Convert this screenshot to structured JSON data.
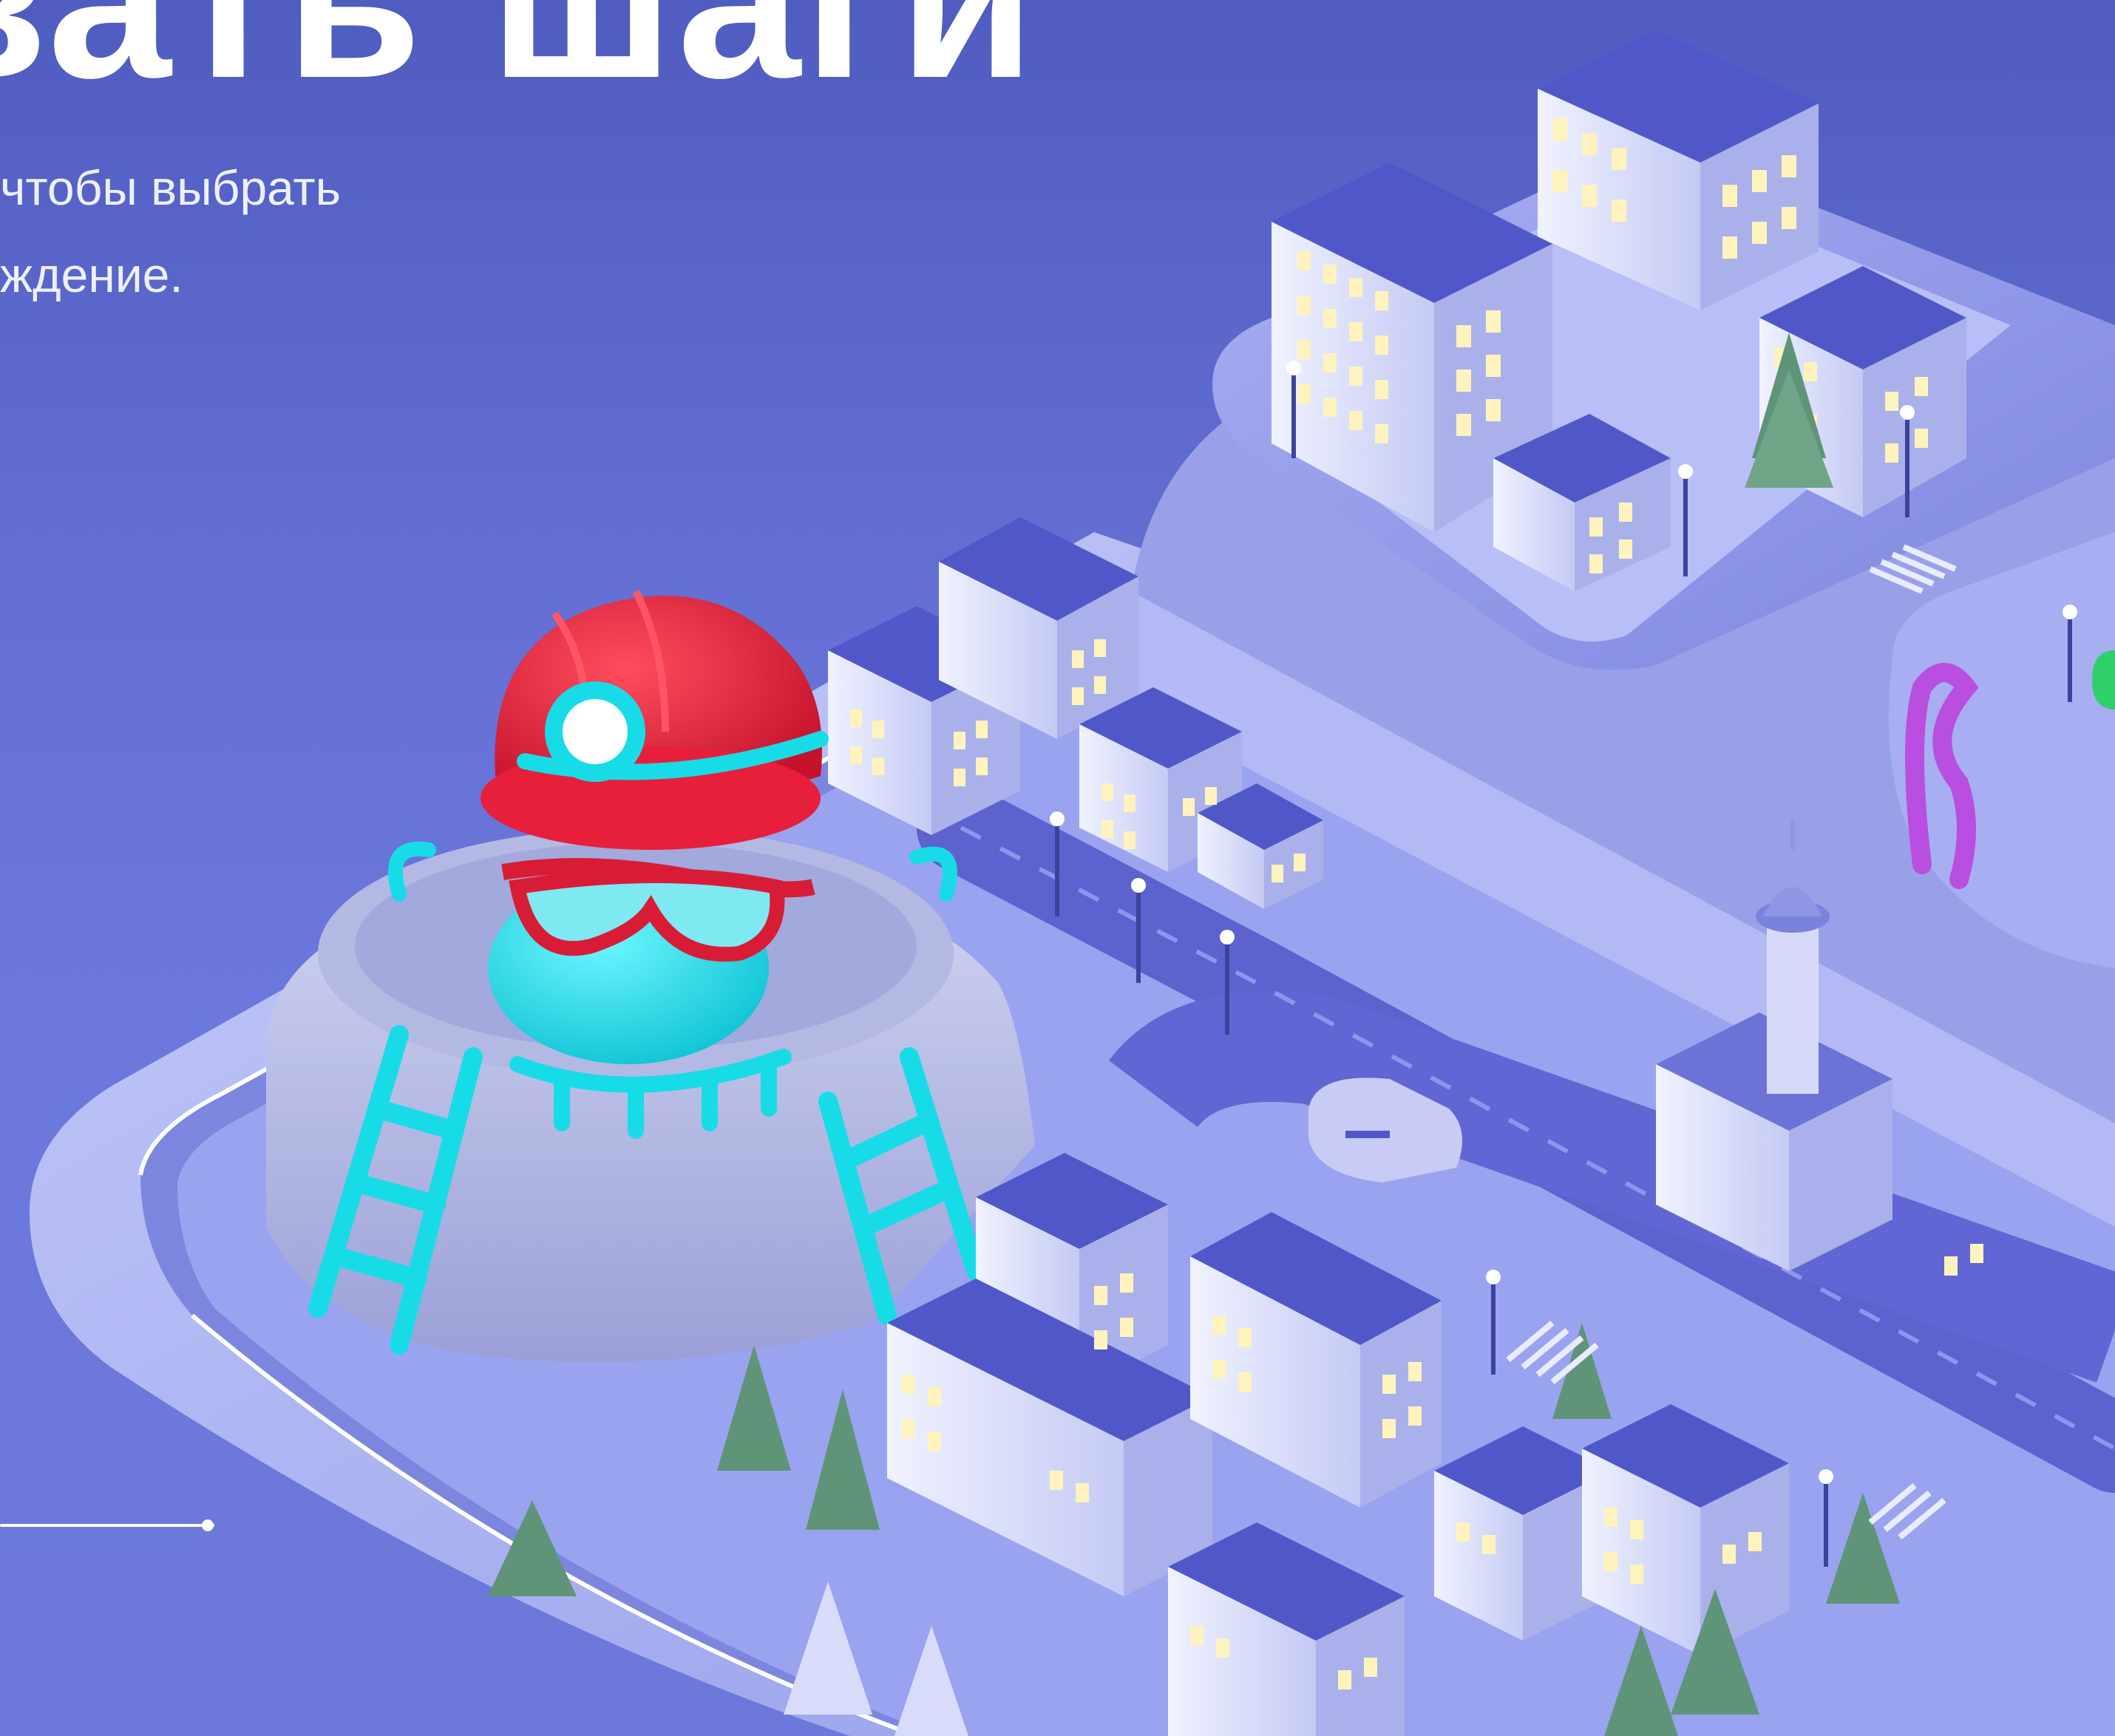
{
  "hero": {
    "title": "вать шаги",
    "subtitle_line1": "чтобы выбрать",
    "subtitle_line2": "ждение."
  },
  "colors": {
    "background_top": "#4f5cc0",
    "background_bottom": "#6c79db",
    "platform": "#b9c2f5",
    "building_wall": "#e4e8ff",
    "building_roof": "#4f56c8",
    "window_lit": "#fff3bd",
    "helmet": "#e81f3a",
    "goggles": "#d91c36",
    "cyan_accent": "#17dce8",
    "tree": "#5f9478"
  },
  "icons": {
    "slider_handle": "dot-icon"
  }
}
